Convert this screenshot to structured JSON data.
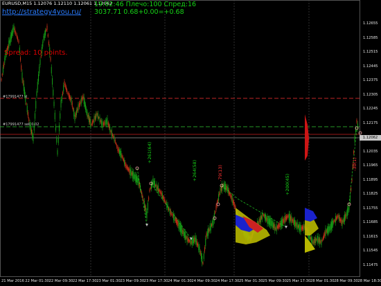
{
  "header": {
    "symbol_title": "EURUSD,M15  1.12076 1.12110 1.12061 1.12062",
    "site_link": "http://strategy4you.ru/",
    "spread_label": "Spread: 10 points.",
    "clock": "19:02:46  Плечо:100  Спред:16",
    "account_line": "3037.71   0.68+0.00=+0.68"
  },
  "order_lines": [
    {
      "label": "#17991477 sl",
      "color": "#ff3333"
    },
    {
      "label": "#17991477 sell 0.02",
      "color": "#33cc33"
    }
  ],
  "price_axis": {
    "ticks": [
      "1.12655",
      "1.12585",
      "1.12515",
      "1.12445",
      "1.12375",
      "1.12305",
      "1.12245",
      "1.12175",
      "1.12105",
      "1.12035",
      "1.11965",
      "1.11895",
      "1.11825",
      "1.11755",
      "1.11685",
      "1.11615",
      "1.11545",
      "1.11475"
    ],
    "current_price": "1.12062"
  },
  "time_axis": {
    "ticks": [
      "21 Mar 2016",
      "22 Mar 01:30",
      "22 Mar 09:30",
      "22 Mar 17:30",
      "23 Mar 01:30",
      "23 Mar 09:30",
      "23 Mar 17:30",
      "24 Mar 01:30",
      "24 Mar 09:30",
      "24 Mar 17:30",
      "25 Mar 01:30",
      "25 Mar 09:30",
      "25 Mar 17:30",
      "28 Mar 01:30",
      "28 Mar 09:30",
      "28 Mar 18:30"
    ]
  },
  "trade_labels": [
    {
      "text": "+261(64)",
      "color": "#16d216"
    },
    {
      "text": "+264(58)",
      "color": "#16d216"
    },
    {
      "text": "-79(13)",
      "color": "#ff3333"
    },
    {
      "text": "+200(45)",
      "color": "#16d216"
    },
    {
      "text": "-30(1)",
      "color": "#ff3333"
    }
  ],
  "colors": {
    "background": "#000000",
    "bull_candle": "#16a016",
    "bear_candle": "#c83218",
    "grid": "#444444",
    "sl_line": "#ff3333",
    "order_line": "#33cc33"
  }
}
